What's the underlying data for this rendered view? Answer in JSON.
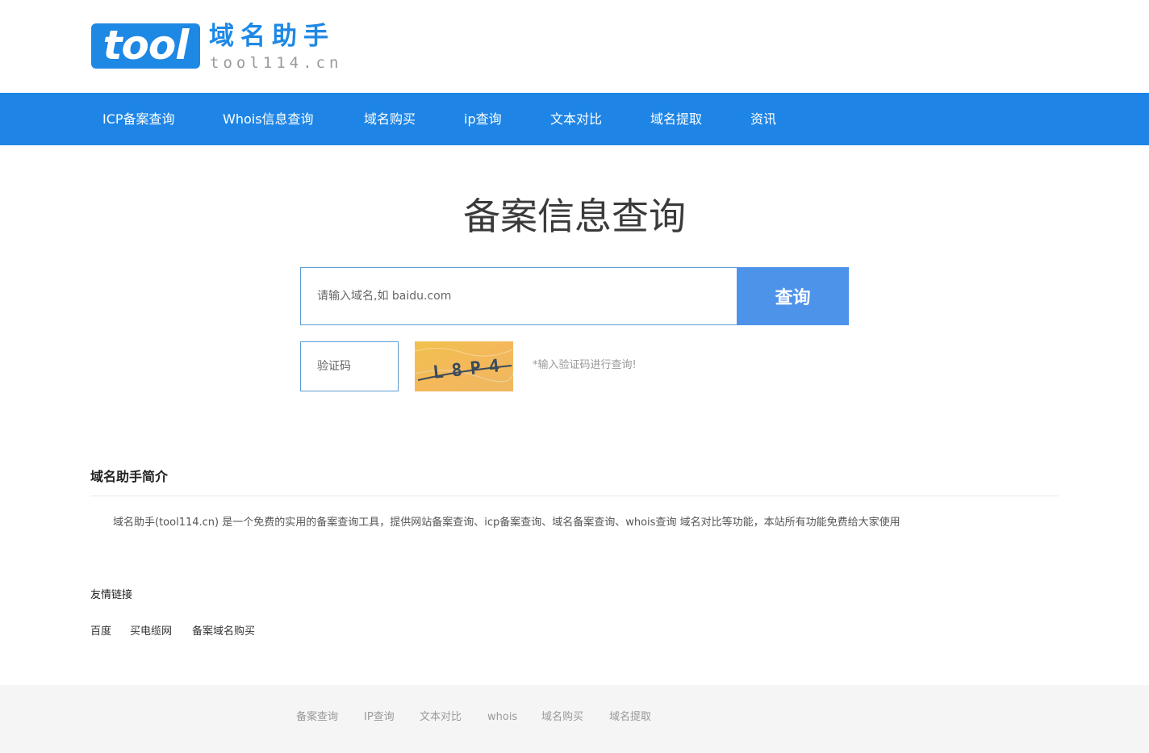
{
  "header": {
    "logo_text": "tool",
    "logo_title": "域名助手",
    "logo_domain": "tool114.cn"
  },
  "nav": {
    "items": [
      {
        "label": "ICP备案查询"
      },
      {
        "label": "Whois信息查询"
      },
      {
        "label": "域名购买"
      },
      {
        "label": "ip查询"
      },
      {
        "label": "文本对比"
      },
      {
        "label": "域名提取"
      },
      {
        "label": "资讯"
      }
    ]
  },
  "main": {
    "title": "备案信息查询",
    "search": {
      "placeholder": "请输入域名,如 baidu.com",
      "button_label": "查询"
    },
    "captcha": {
      "placeholder": "验证码",
      "image_text": "L8P4",
      "hint": "*输入验证码进行查询!"
    }
  },
  "intro": {
    "title": "域名助手简介",
    "text": "域名助手(tool114.cn) 是一个免费的实用的备案查询工具，提供网站备案查询、icp备案查询、域名备案查询、whois查询 域名对比等功能，本站所有功能免费给大家使用"
  },
  "friend_links": {
    "title": "友情链接",
    "items": [
      {
        "label": "百度"
      },
      {
        "label": "买电缆网"
      },
      {
        "label": "备案域名购买"
      }
    ]
  },
  "footer": {
    "items": [
      {
        "label": "备案查询"
      },
      {
        "label": "IP查询"
      },
      {
        "label": "文本对比"
      },
      {
        "label": "whois"
      },
      {
        "label": "域名购买"
      },
      {
        "label": "域名提取"
      }
    ]
  },
  "colors": {
    "brand": "#1e85e6",
    "search_button": "#4e93ea",
    "input_border": "#5b9bd5",
    "footer_bg": "#f5f5f5"
  }
}
